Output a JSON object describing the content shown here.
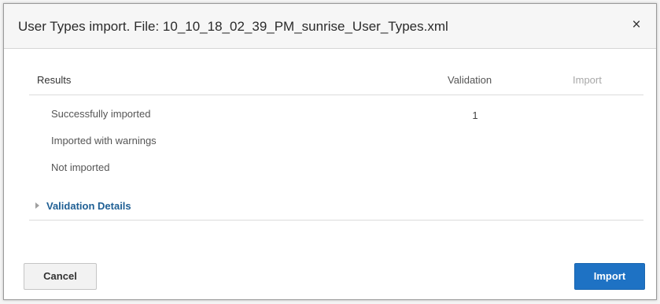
{
  "dialog": {
    "title": "User Types import. File: 10_10_18_02_39_PM_sunrise_User_Types.xml",
    "close_glyph": "×"
  },
  "results_table": {
    "headers": {
      "results": "Results",
      "validation": "Validation",
      "import": "Import"
    },
    "rows": [
      {
        "label": "Successfully imported",
        "validation": "1",
        "import": ""
      },
      {
        "label": "Imported with warnings",
        "validation": "",
        "import": ""
      },
      {
        "label": "Not imported",
        "validation": "",
        "import": ""
      }
    ]
  },
  "validation_details": {
    "label": "Validation Details",
    "expanded": false
  },
  "footer": {
    "cancel_label": "Cancel",
    "import_label": "Import"
  },
  "colors": {
    "primary_button": "#1e72c4",
    "link": "#1f5f94",
    "disabled_header": "#a8a8a8"
  },
  "icons": {
    "close": "close-icon",
    "expand": "disclosure-triangle-icon"
  }
}
